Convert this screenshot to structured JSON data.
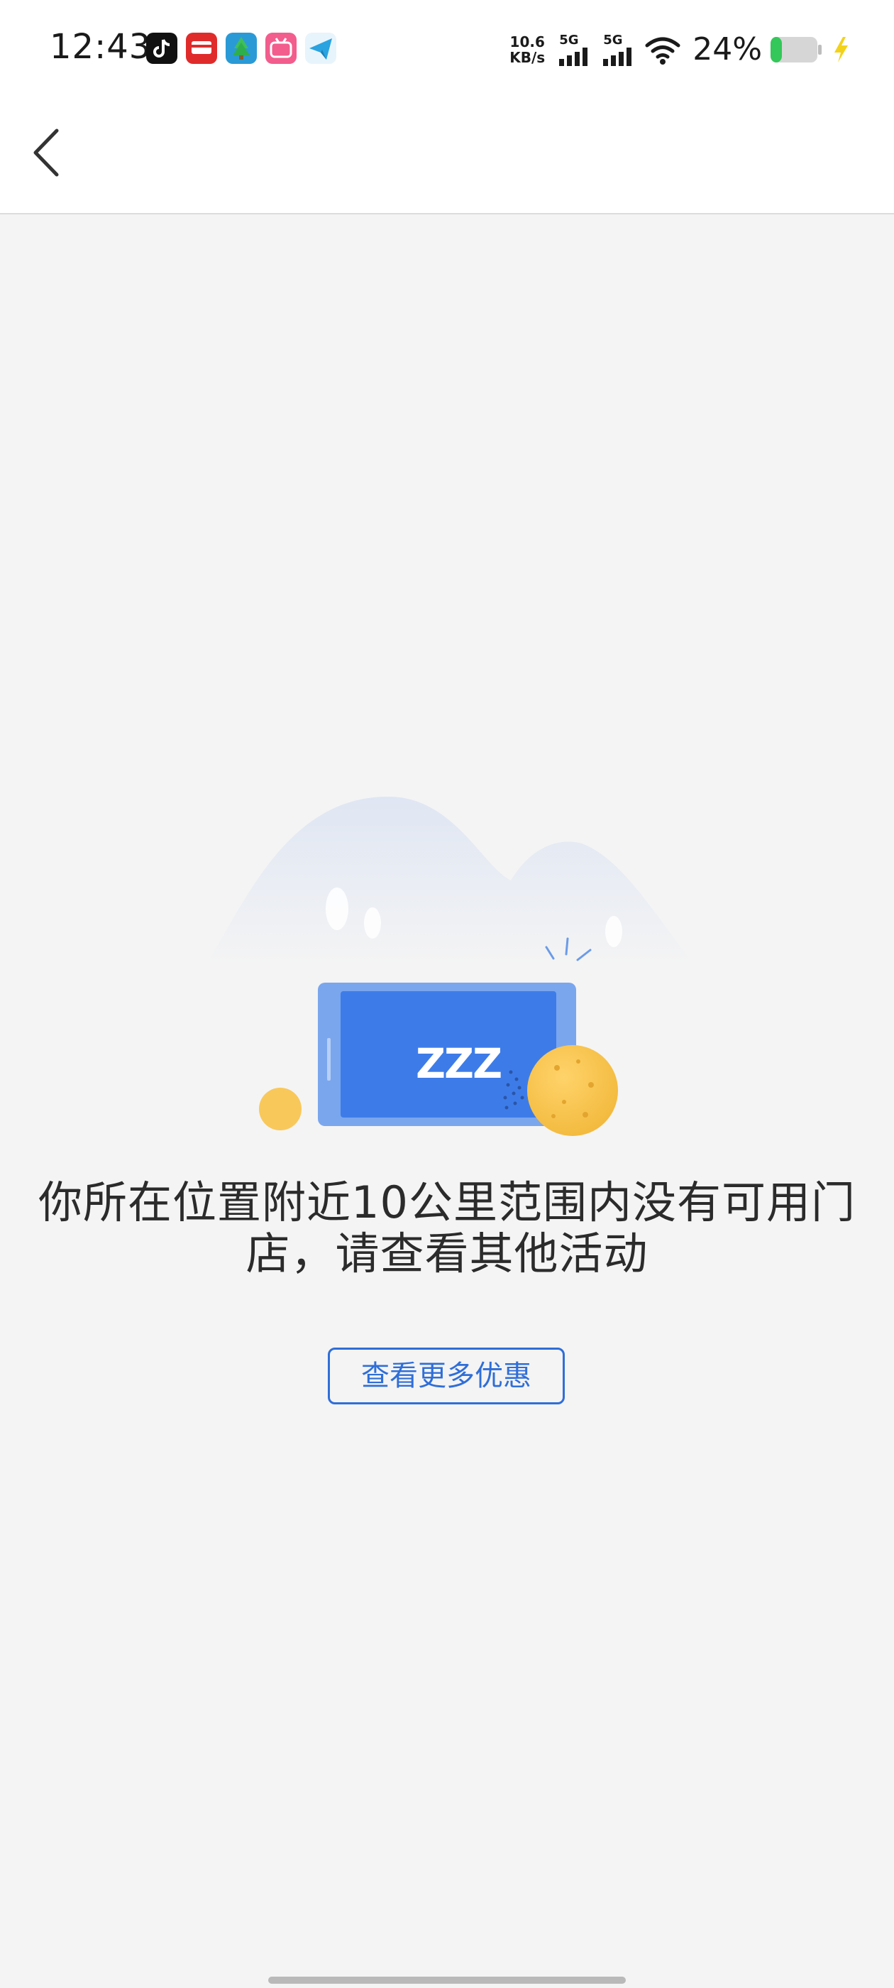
{
  "status_bar": {
    "time": "12:43",
    "net_speed_value": "10.6",
    "net_speed_unit": "KB/s",
    "sim1_type": "5G",
    "sim2_type": "5G",
    "battery_percent": "24%",
    "battery_level": 0.24,
    "notification_icons": [
      "tiktok-icon",
      "unionpay-icon",
      "tree-app-icon",
      "bilibili-icon",
      "telegram-icon"
    ]
  },
  "nav": {
    "back_icon": "chevron-left-icon"
  },
  "empty_state": {
    "illustration": "sleeping-phone-illustration",
    "sleep_text": "ZZZ",
    "message_line1": "你所在位置附近10公里范围内没有可用门",
    "message_line2": "店，请查看其他活动",
    "button_label": "查看更多优惠"
  },
  "colors": {
    "accent": "#2f6ed8",
    "phone_blue": "#3d7ce8",
    "coin_yellow": "#f6c24f",
    "background": "#f4f4f4"
  }
}
